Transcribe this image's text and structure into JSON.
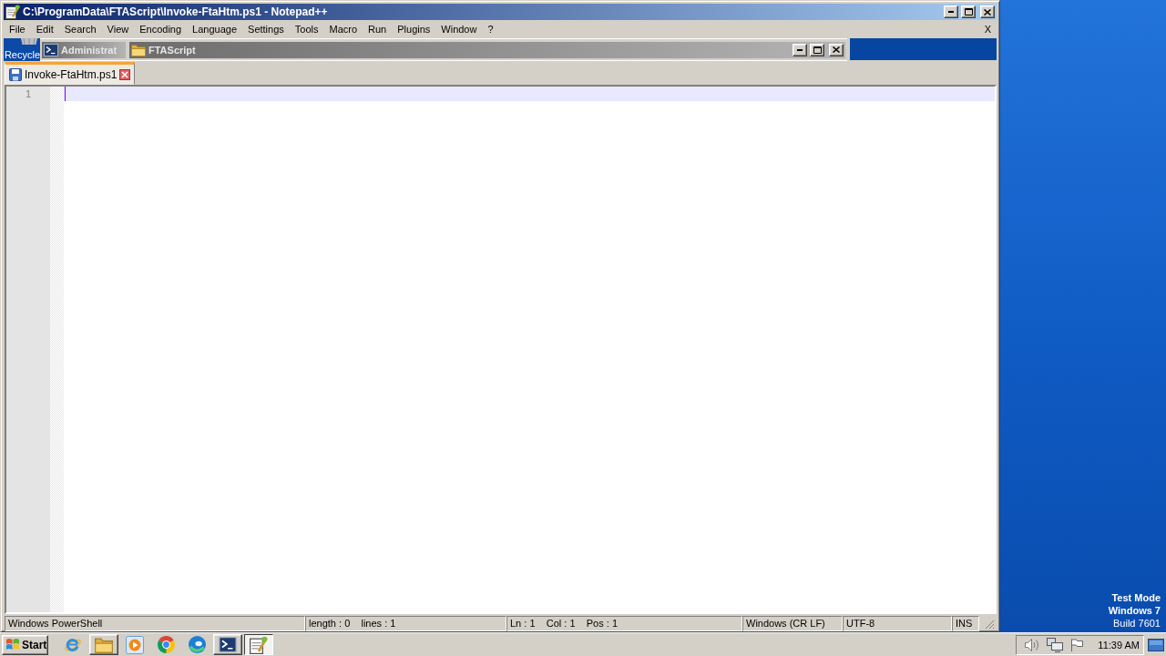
{
  "window": {
    "title": "C:\\ProgramData\\FTAScript\\Invoke-FtaHtm.ps1 - Notepad++",
    "active": true
  },
  "menu": {
    "items": [
      "File",
      "Edit",
      "Search",
      "View",
      "Encoding",
      "Language",
      "Settings",
      "Tools",
      "Macro",
      "Run",
      "Plugins",
      "Window",
      "?"
    ],
    "close_label": "X"
  },
  "desktop_icon": {
    "label": "Recycle"
  },
  "background_windows": [
    {
      "kind": "console",
      "title": "Administrat",
      "active": false
    },
    {
      "kind": "folder",
      "title": "FTAScript",
      "active": false
    }
  ],
  "tabs": [
    {
      "label": "Invoke-FtaHtm.ps1",
      "selected": true
    }
  ],
  "editor": {
    "lines": [
      {
        "number": "1",
        "current": true
      }
    ]
  },
  "status_bar": [
    "Windows PowerShell",
    "length : 0    lines : 1",
    "Ln : 1    Col : 1    Pos : 1",
    "Windows (CR LF)",
    "UTF-8",
    "INS"
  ],
  "desktop_text": [
    {
      "kind": "title",
      "text": "Test Mode"
    },
    {
      "kind": "title",
      "text": "Windows 7"
    },
    {
      "kind": "build",
      "text": "Build 7601"
    }
  ],
  "taskbar": {
    "start": "Start",
    "apps": [
      {
        "kind": "ie",
        "open": false,
        "selected": false
      },
      {
        "kind": "explorer",
        "open": true,
        "selected": false
      },
      {
        "kind": "media",
        "open": false,
        "selected": false
      },
      {
        "kind": "chrome",
        "open": false,
        "selected": false
      },
      {
        "kind": "edge",
        "open": false,
        "selected": false
      },
      {
        "kind": "powershell",
        "open": true,
        "selected": false
      },
      {
        "kind": "notepad",
        "open": true,
        "selected": true
      }
    ],
    "clock": "11:39 AM"
  }
}
